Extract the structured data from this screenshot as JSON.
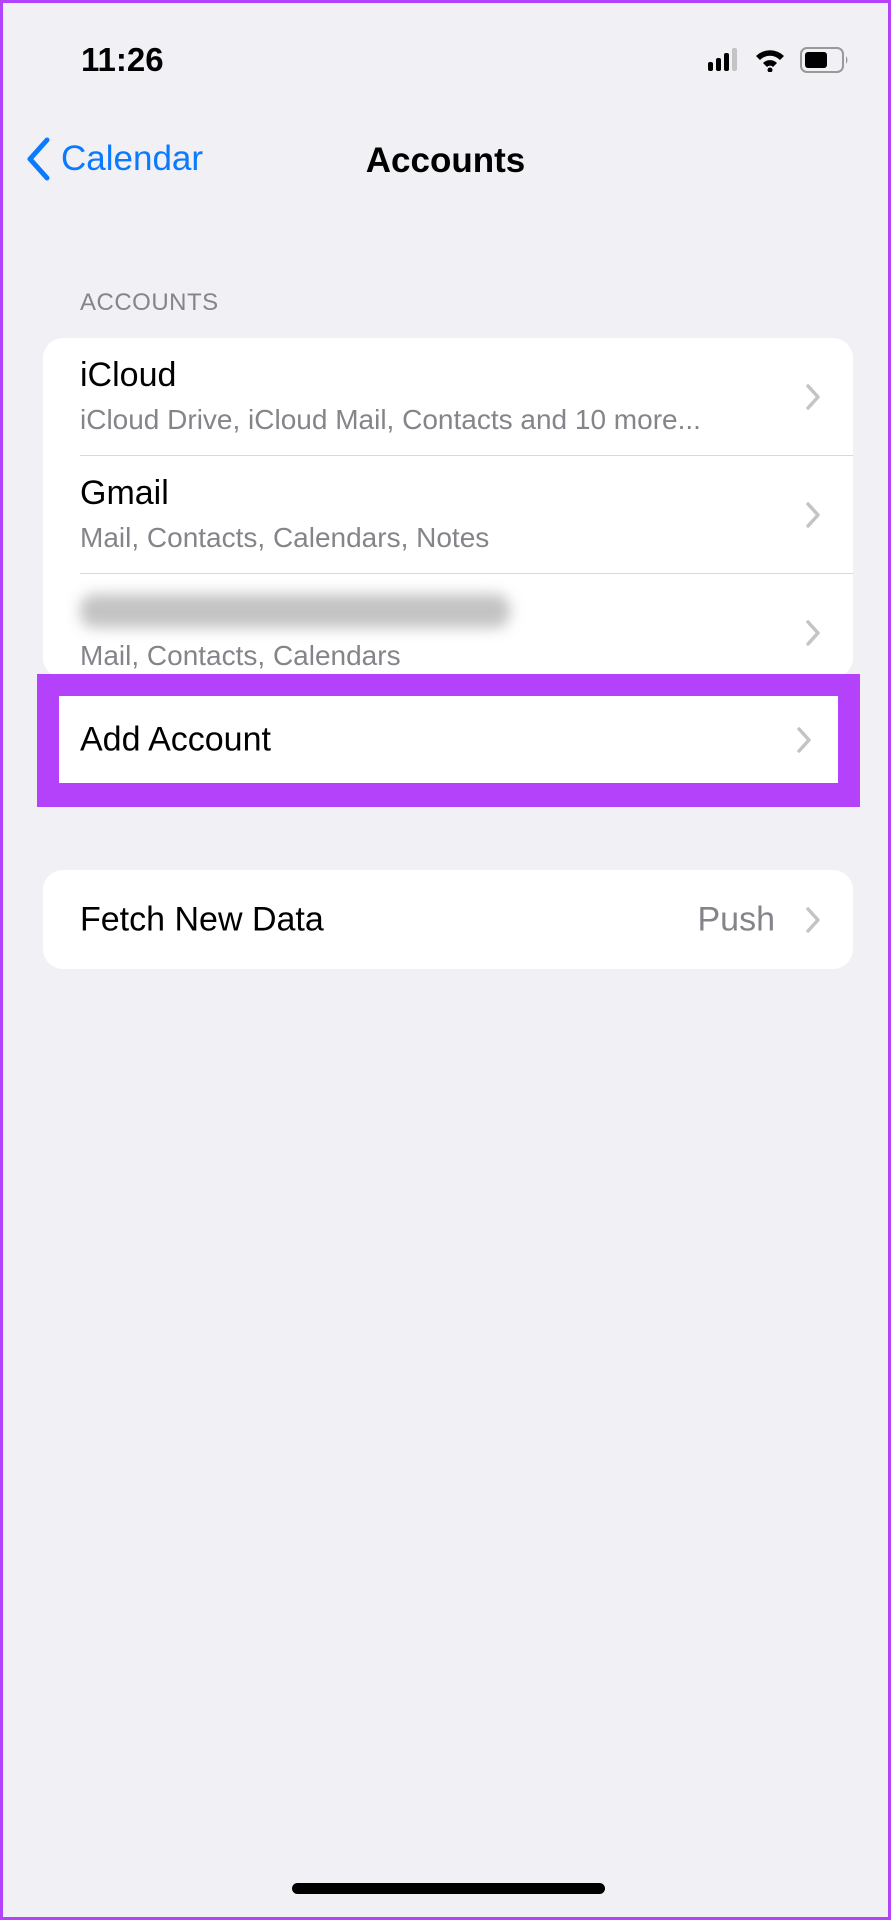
{
  "status_bar": {
    "time": "11:26",
    "icons": [
      "cellular-signal-icon",
      "wifi-icon",
      "battery-icon"
    ]
  },
  "nav": {
    "back_label": "Calendar",
    "title": "Accounts"
  },
  "accounts_section": {
    "header": "ACCOUNTS",
    "items": [
      {
        "title": "iCloud",
        "subtitle": "iCloud Drive, iCloud Mail, Contacts and 10 more..."
      },
      {
        "title": "Gmail",
        "subtitle": "Mail, Contacts, Calendars, Notes"
      },
      {
        "title": "",
        "subtitle": "Mail, Contacts, Calendars",
        "title_blurred": true
      }
    ],
    "add_account_label": "Add Account"
  },
  "fetch": {
    "label": "Fetch New Data",
    "value": "Push"
  },
  "colors": {
    "accent": "#0a7aff",
    "highlight": "#b442fb",
    "background": "#f1f0f5"
  }
}
